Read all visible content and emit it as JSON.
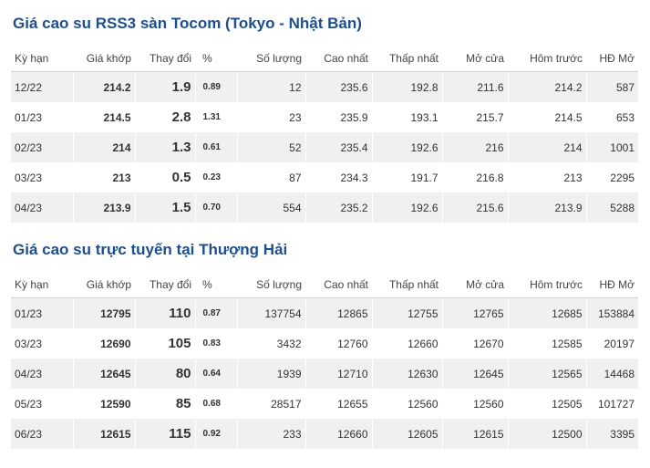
{
  "colors": {
    "title": "#1f4e8c",
    "positive": "#3b9a1c",
    "row_stripe": "#f0f0f0"
  },
  "headers": [
    "Kỳ hạn",
    "Giá khớp",
    "Thay đổi",
    "%",
    "Số lượng",
    "Cao nhất",
    "Thấp nhất",
    "Mở cửa",
    "Hôm trước",
    "HĐ Mở"
  ],
  "tocom": {
    "title": "Giá cao su RSS3 sàn Tocom (Tokyo - Nhật Bản)",
    "rows": [
      [
        "12/22",
        "214.2",
        "1.9",
        "0.89",
        "12",
        "235.6",
        "192.8",
        "211.6",
        "214.2",
        "587"
      ],
      [
        "01/23",
        "214.5",
        "2.8",
        "1.31",
        "23",
        "235.9",
        "193.1",
        "215.7",
        "214.5",
        "653"
      ],
      [
        "02/23",
        "214",
        "1.3",
        "0.61",
        "52",
        "235.4",
        "192.6",
        "216",
        "214",
        "1001"
      ],
      [
        "03/23",
        "213",
        "0.5",
        "0.23",
        "87",
        "234.3",
        "191.7",
        "216.8",
        "213",
        "2295"
      ],
      [
        "04/23",
        "213.9",
        "1.5",
        "0.70",
        "554",
        "235.2",
        "192.6",
        "215.6",
        "213.9",
        "5288"
      ]
    ]
  },
  "shanghai": {
    "title": "Giá cao su trực tuyến tại Thượng Hải",
    "rows": [
      [
        "01/23",
        "12795",
        "110",
        "0.87",
        "137754",
        "12865",
        "12755",
        "12765",
        "12685",
        "153884"
      ],
      [
        "03/23",
        "12690",
        "105",
        "0.83",
        "3432",
        "12760",
        "12660",
        "12670",
        "12585",
        "20197"
      ],
      [
        "04/23",
        "12645",
        "80",
        "0.64",
        "1939",
        "12710",
        "12630",
        "12645",
        "12565",
        "14468"
      ],
      [
        "05/23",
        "12590",
        "85",
        "0.68",
        "28517",
        "12655",
        "12560",
        "12560",
        "12505",
        "101727"
      ],
      [
        "06/23",
        "12615",
        "115",
        "0.92",
        "233",
        "12660",
        "12605",
        "12615",
        "12500",
        "3395"
      ]
    ]
  }
}
